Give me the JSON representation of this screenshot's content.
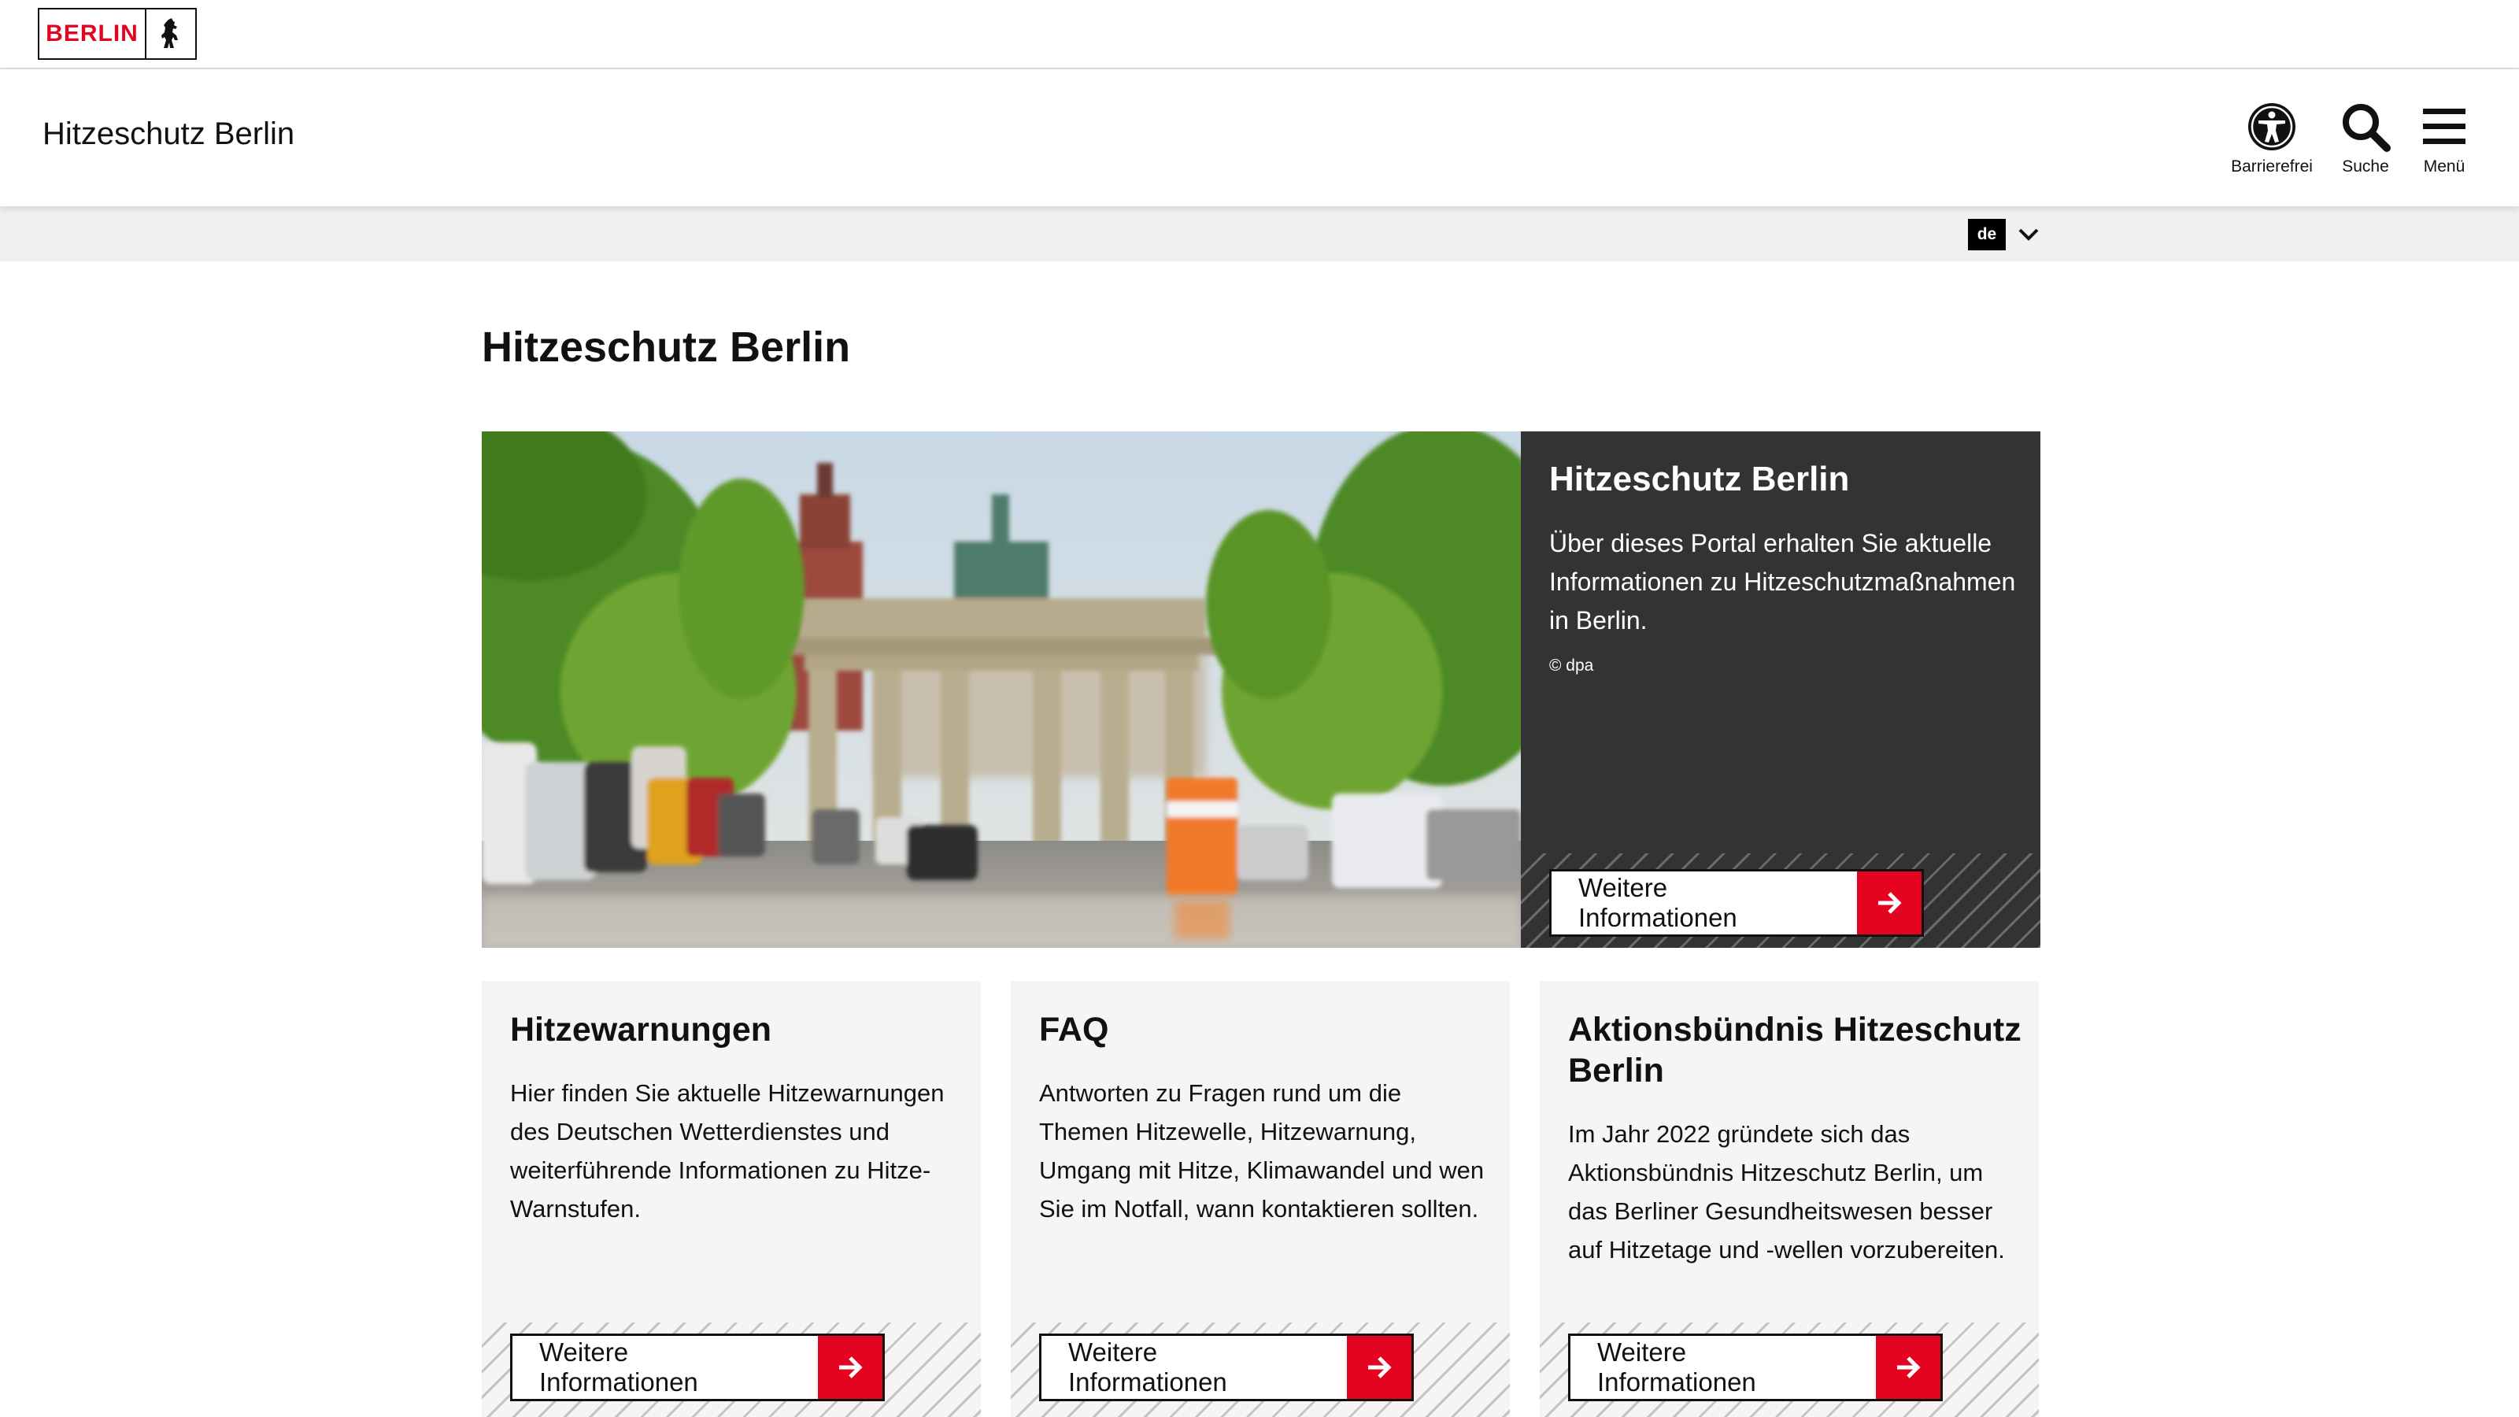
{
  "logo": {
    "text": "BERLIN"
  },
  "header": {
    "site_title": "Hitzeschutz Berlin",
    "tools": {
      "accessibility": "Barrierefrei",
      "search": "Suche",
      "menu": "Menü"
    }
  },
  "language": {
    "selected": "de"
  },
  "main": {
    "page_title": "Hitzeschutz Berlin",
    "hero": {
      "title": "Hitzeschutz Berlin",
      "description": "Über dieses Portal erhalten Sie aktuelle Informationen zu Hitzeschutzmaß­nahmen in Berlin.",
      "credit": "© dpa",
      "cta": "Weitere Informationen"
    },
    "cards": [
      {
        "title": "Hitzewarnungen",
        "text": "Hier finden Sie aktuelle Hitzewarnungen des Deutschen Wetterdienstes und weiterführende Informationen zu Hitze-Warnstufen.",
        "cta": "Weitere Informationen"
      },
      {
        "title": "FAQ",
        "text": "Antworten zu Fragen rund um die Themen Hitzewelle, Hitzewarnung, Umgang mit Hitze, Klimawandel und wen Sie im Notfall, wann kontaktieren sollten.",
        "cta": "Weitere Informationen"
      },
      {
        "title": "Aktionsbündnis Hitzeschutz Berlin",
        "text": "Im Jahr 2022 gründete sich das Aktionsbündnis Hitzeschutz Berlin, um das Berliner Gesundheitswesen besser auf Hitzetage und -wellen vorzubereiten.",
        "cta": "Weitere Informationen"
      }
    ]
  },
  "colors": {
    "brand_red": "#e40422",
    "panel_dark": "#333333",
    "card_bg": "#f5f5f5",
    "lang_bar_bg": "#f0f0f0"
  },
  "icons": {
    "logo": "berlin-bear-icon",
    "accessibility": "accessibility-icon",
    "search": "search-icon",
    "menu": "hamburger-menu-icon",
    "language": "chevron-down-icon",
    "cta": "arrow-right-icon"
  }
}
